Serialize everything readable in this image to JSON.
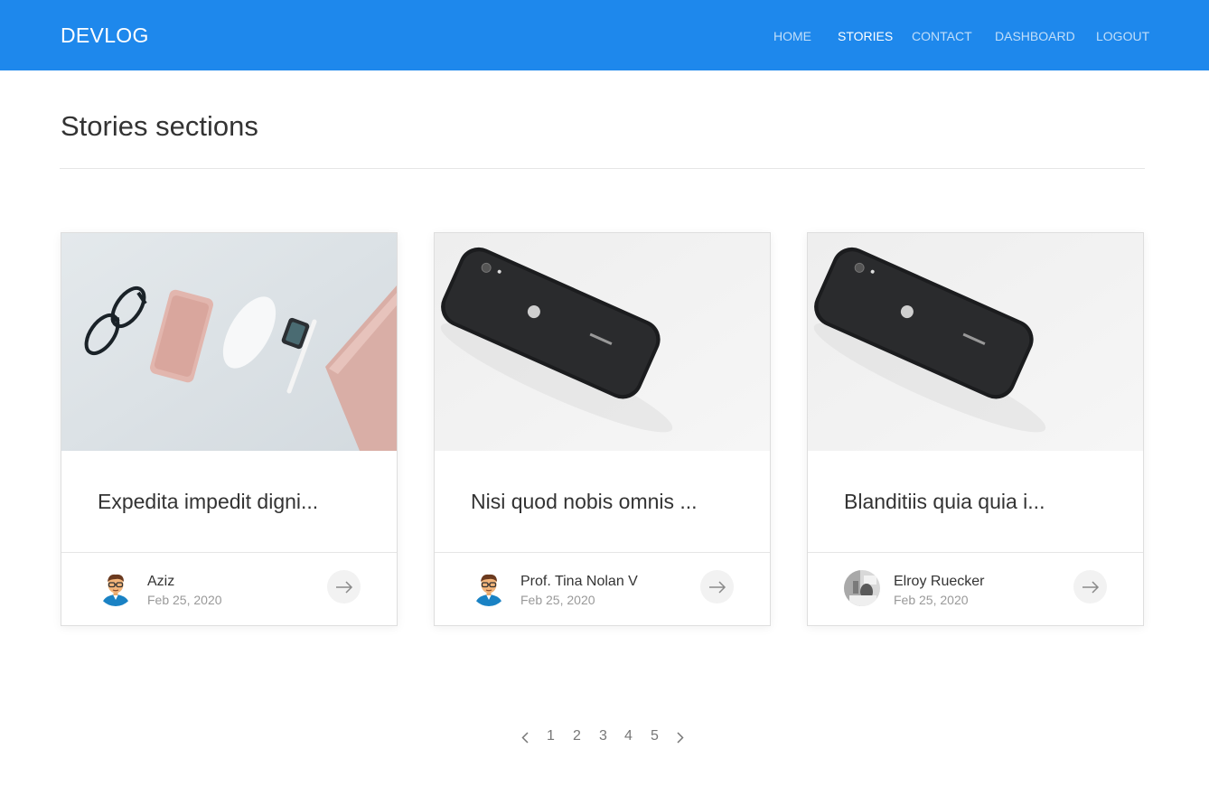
{
  "nav": {
    "brand": "DEVLOG",
    "links": [
      {
        "label": "HOME",
        "active": false
      },
      {
        "label": "STORIES",
        "active": true
      },
      {
        "label": "CONTACT",
        "active": false
      },
      {
        "label": "DASHBOARD",
        "active": false
      },
      {
        "label": "LOGOUT",
        "active": false
      }
    ]
  },
  "page": {
    "title": "Stories sections"
  },
  "stories": [
    {
      "title": "Expedita impedit digni...",
      "author": "Aziz",
      "date": "Feb 25, 2020",
      "image": "desk-accessories-photo",
      "avatar": "man-glasses-avatar-icon"
    },
    {
      "title": "Nisi quod nobis omnis ...",
      "author": "Prof. Tina Nolan V",
      "date": "Feb 25, 2020",
      "image": "black-iphone-photo",
      "avatar": "man-glasses-avatar-icon"
    },
    {
      "title": "Blanditiis quia quia i...",
      "author": "Elroy Ruecker",
      "date": "Feb 25, 2020",
      "image": "black-iphone-photo",
      "avatar": "grayscale-photo-avatar"
    }
  ],
  "pagination": {
    "pages": [
      "1",
      "2",
      "3",
      "4",
      "5"
    ],
    "prev": "chevron-left-icon",
    "next": "chevron-right-icon"
  },
  "colors": {
    "primary": "#1e88ec",
    "text": "#333333",
    "muted": "#999999"
  }
}
